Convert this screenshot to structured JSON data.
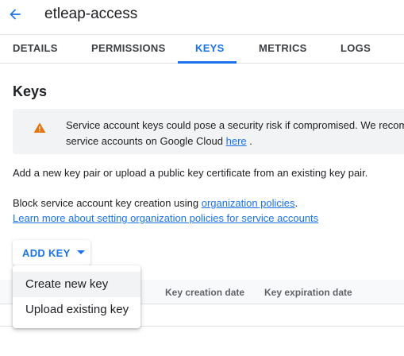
{
  "header": {
    "title": "etleap-access"
  },
  "tabs": [
    {
      "label": "DETAILS",
      "active": false
    },
    {
      "label": "PERMISSIONS",
      "active": false
    },
    {
      "label": "KEYS",
      "active": true
    },
    {
      "label": "METRICS",
      "active": false
    },
    {
      "label": "LOGS",
      "active": false
    }
  ],
  "section": {
    "title": "Keys"
  },
  "warning": {
    "line1": "Service account keys could pose a security risk if compromised. We recom",
    "line2_prefix": "service accounts on Google Cloud ",
    "line2_link": "here",
    "line2_suffix": " ."
  },
  "body": {
    "add_text": "Add a new key pair or upload a public key certificate from an existing key pair.",
    "block_prefix": "Block service account key creation using ",
    "block_link": "organization policies",
    "block_suffix": ".",
    "learn_link": "Learn more about setting organization policies for service accounts"
  },
  "add_key": {
    "label": "ADD KEY"
  },
  "menu": {
    "items": [
      {
        "label": "Create new key"
      },
      {
        "label": "Upload existing key"
      }
    ]
  },
  "table": {
    "columns": [
      "Key creation date",
      "Key expiration date"
    ]
  },
  "colors": {
    "accent": "#1a73e8",
    "warning": "#e8710a"
  }
}
